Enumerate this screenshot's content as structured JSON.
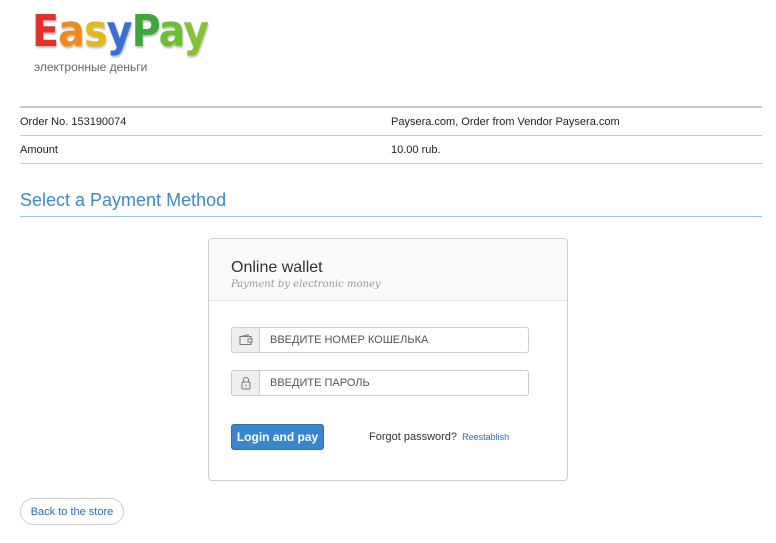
{
  "brand": {
    "letters": [
      "E",
      "a",
      "s",
      "y",
      "P",
      "a",
      "y"
    ],
    "subtitle": "электронные деньги",
    "colors": [
      "#e0322b",
      "#f08a1c",
      "#e2b81b",
      "#3b6fd0",
      "#3fa63b",
      "#6cbf2f",
      "#87c233"
    ]
  },
  "order": {
    "rows": [
      {
        "label": "Order No. 153190074",
        "value": "Paysera.com, Order from Vendor Paysera.com"
      },
      {
        "label": "Amount",
        "value": "10.00 rub."
      }
    ]
  },
  "section": {
    "title": "Select a Payment Method"
  },
  "wallet": {
    "title": "Online wallet",
    "subtitle": "Payment by electronic money",
    "wallet_field": {
      "placeholder": "ВВЕДИТЕ НОМЕР КОШЕЛЬКА",
      "value": "",
      "icon": "wallet-icon"
    },
    "password_field": {
      "placeholder": "ВВЕДИТЕ ПАРОЛЬ",
      "value": "",
      "icon": "lock-icon"
    },
    "login_button": "Login and pay",
    "forgot_text": "Forgot password?",
    "reestablish_link": "Reestablish"
  },
  "back_button": "Back to the store",
  "colors": {
    "accent": "#3b8bc6",
    "button": "#3a86cc",
    "link": "#2a6fb5"
  }
}
